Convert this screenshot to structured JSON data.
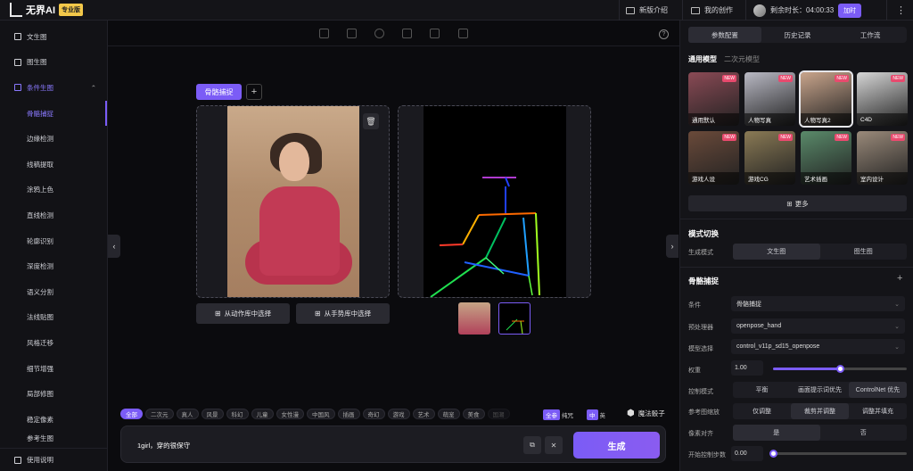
{
  "top": {
    "logo_text": "无界AI",
    "logo_badge": "专业版",
    "new_intro": "新版介绍",
    "my_creations": "我的创作",
    "remaining_label": "剩余时长：04:00:33",
    "charge": "加时",
    "more": "⋮"
  },
  "sidebar": {
    "items": [
      {
        "label": "文生图"
      },
      {
        "label": "图生图"
      },
      {
        "label": "条件生图"
      }
    ],
    "sub_items": [
      {
        "label": "骨骼捕捉"
      },
      {
        "label": "边缘检测"
      },
      {
        "label": "线稿提取"
      },
      {
        "label": "涂鸦上色"
      },
      {
        "label": "直线检测"
      },
      {
        "label": "轮廓识别"
      },
      {
        "label": "深度检测"
      },
      {
        "label": "语义分割"
      },
      {
        "label": "法线贴图"
      },
      {
        "label": "风格迁移"
      },
      {
        "label": "细节增强"
      },
      {
        "label": "局部修图"
      },
      {
        "label": "稳定像素"
      },
      {
        "label": "参考生图"
      }
    ],
    "footer": "使用说明"
  },
  "canvas": {
    "pose_tab": "骨骼捕捉",
    "add_tab": "+",
    "select_action": "从动作库中选择",
    "select_gesture": "从手势库中选择",
    "help": "?"
  },
  "tags": [
    "全部",
    "二次元",
    "真人",
    "风景",
    "科幻",
    "儿童",
    "女性漫",
    "中国风",
    "插画",
    "奇幻",
    "游戏",
    "艺术",
    "萌宠",
    "美食",
    "国潮"
  ],
  "lang": {
    "a": "全参",
    "b": "纯咒",
    "c": "中",
    "d": "英"
  },
  "magic_dice": "魔法骰子",
  "prompt": {
    "text": "1girl，穿的很保守",
    "copy": "⧉",
    "clear": "✕",
    "generate": "生成"
  },
  "right": {
    "tabs": [
      "参数配置",
      "历史记录",
      "工作流"
    ],
    "model_tabs": [
      "通用模型",
      "二次元模型"
    ],
    "models": [
      {
        "label": "通用默认",
        "new": "NEW",
        "bg": "#8a4a55"
      },
      {
        "label": "人物写真",
        "new": "NEW",
        "bg": "#b9b9c4"
      },
      {
        "label": "人物写真2",
        "new": "NEW",
        "bg": "#c9a58c"
      },
      {
        "label": "C4D",
        "new": "NEW",
        "bg": "#d6d6d6"
      },
      {
        "label": "游戏人设",
        "new": "NEW",
        "bg": "#6a4a3a"
      },
      {
        "label": "游戏CG",
        "new": "NEW",
        "bg": "#8a7a55"
      },
      {
        "label": "艺术插画",
        "new": "NEW",
        "bg": "#5a8a6a"
      },
      {
        "label": "室内设计",
        "new": "NEW",
        "bg": "#9a8a7a"
      }
    ],
    "more": "更多",
    "mode_section": "模式切换",
    "mode_label": "生成模式",
    "mode_options": [
      "文生图",
      "图生图"
    ],
    "pose_section": "骨骼捕捉",
    "plus": "+",
    "condition_label": "条件",
    "condition_value": "骨骼捕捉",
    "preprocessor_label": "预处理器",
    "preprocessor_value": "openpose_hand",
    "model_label": "模型选择",
    "model_value": "control_v11p_sd15_openpose",
    "weight_label": "权重",
    "weight_value": "1.00",
    "weight_level": 0.5,
    "control_label": "控制模式",
    "control_options": [
      "平衡",
      "画面提示词优先",
      "ControlNet 优先"
    ],
    "ref_label": "参考图缩放",
    "ref_options": [
      "仅调整",
      "裁剪并调整",
      "调整并填充"
    ],
    "pixel_label": "像素对齐",
    "pixel_options": [
      "是",
      "否"
    ],
    "start_label": "开始控制步数",
    "start_value": "0.00",
    "start_level": 0
  }
}
